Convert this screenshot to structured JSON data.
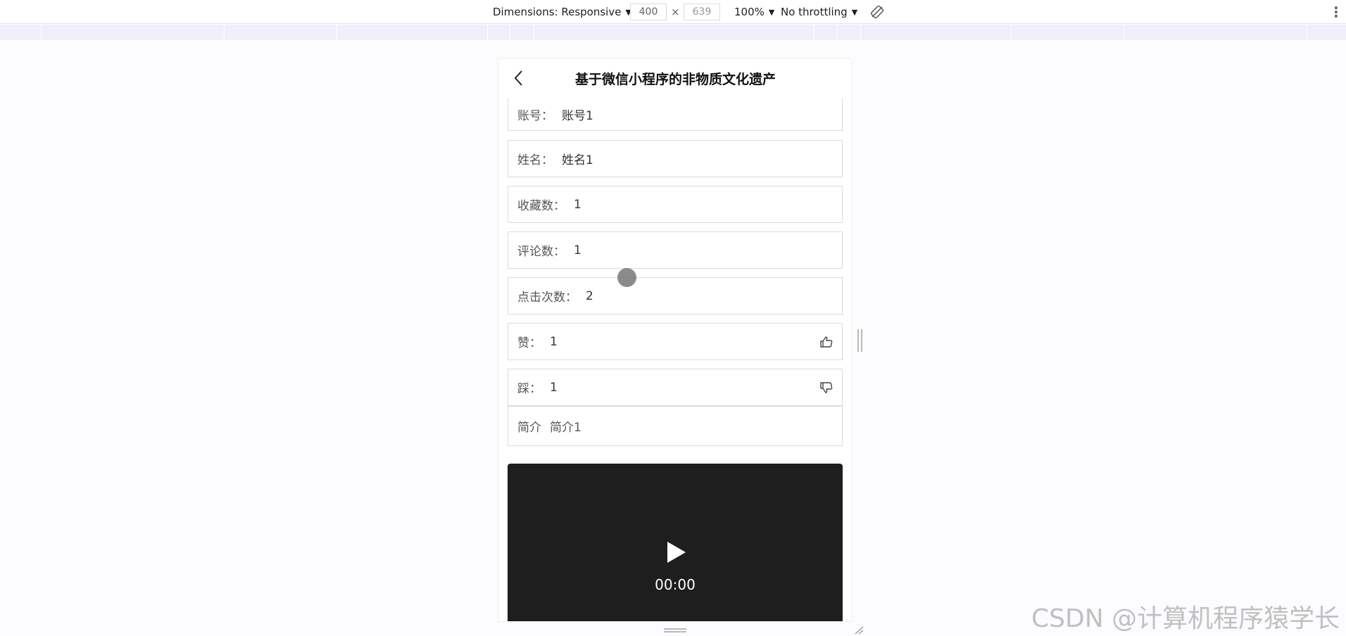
{
  "devtools": {
    "dimensions_label": "Dimensions: Responsive",
    "width": "400",
    "times": "×",
    "height": "639",
    "zoom": "100%",
    "throttling": "No throttling",
    "caret": "▼"
  },
  "page": {
    "title": "基于微信小程序的非物质文化遗产"
  },
  "fields": [
    {
      "label": "账号：",
      "value": "账号1"
    },
    {
      "label": "姓名：",
      "value": "姓名1"
    },
    {
      "label": "收藏数：",
      "value": "1"
    },
    {
      "label": "评论数：",
      "value": "1"
    },
    {
      "label": "点击次数：",
      "value": "2"
    },
    {
      "label": "赞：",
      "value": "1",
      "icon": "thumbs-up-icon"
    },
    {
      "label": "踩：",
      "value": "1",
      "icon": "thumbs-down-icon"
    }
  ],
  "intro": {
    "label": "简介",
    "value": "简介1"
  },
  "video": {
    "time": "00:00"
  },
  "watermark": "CSDN @计算机程序猿学长"
}
